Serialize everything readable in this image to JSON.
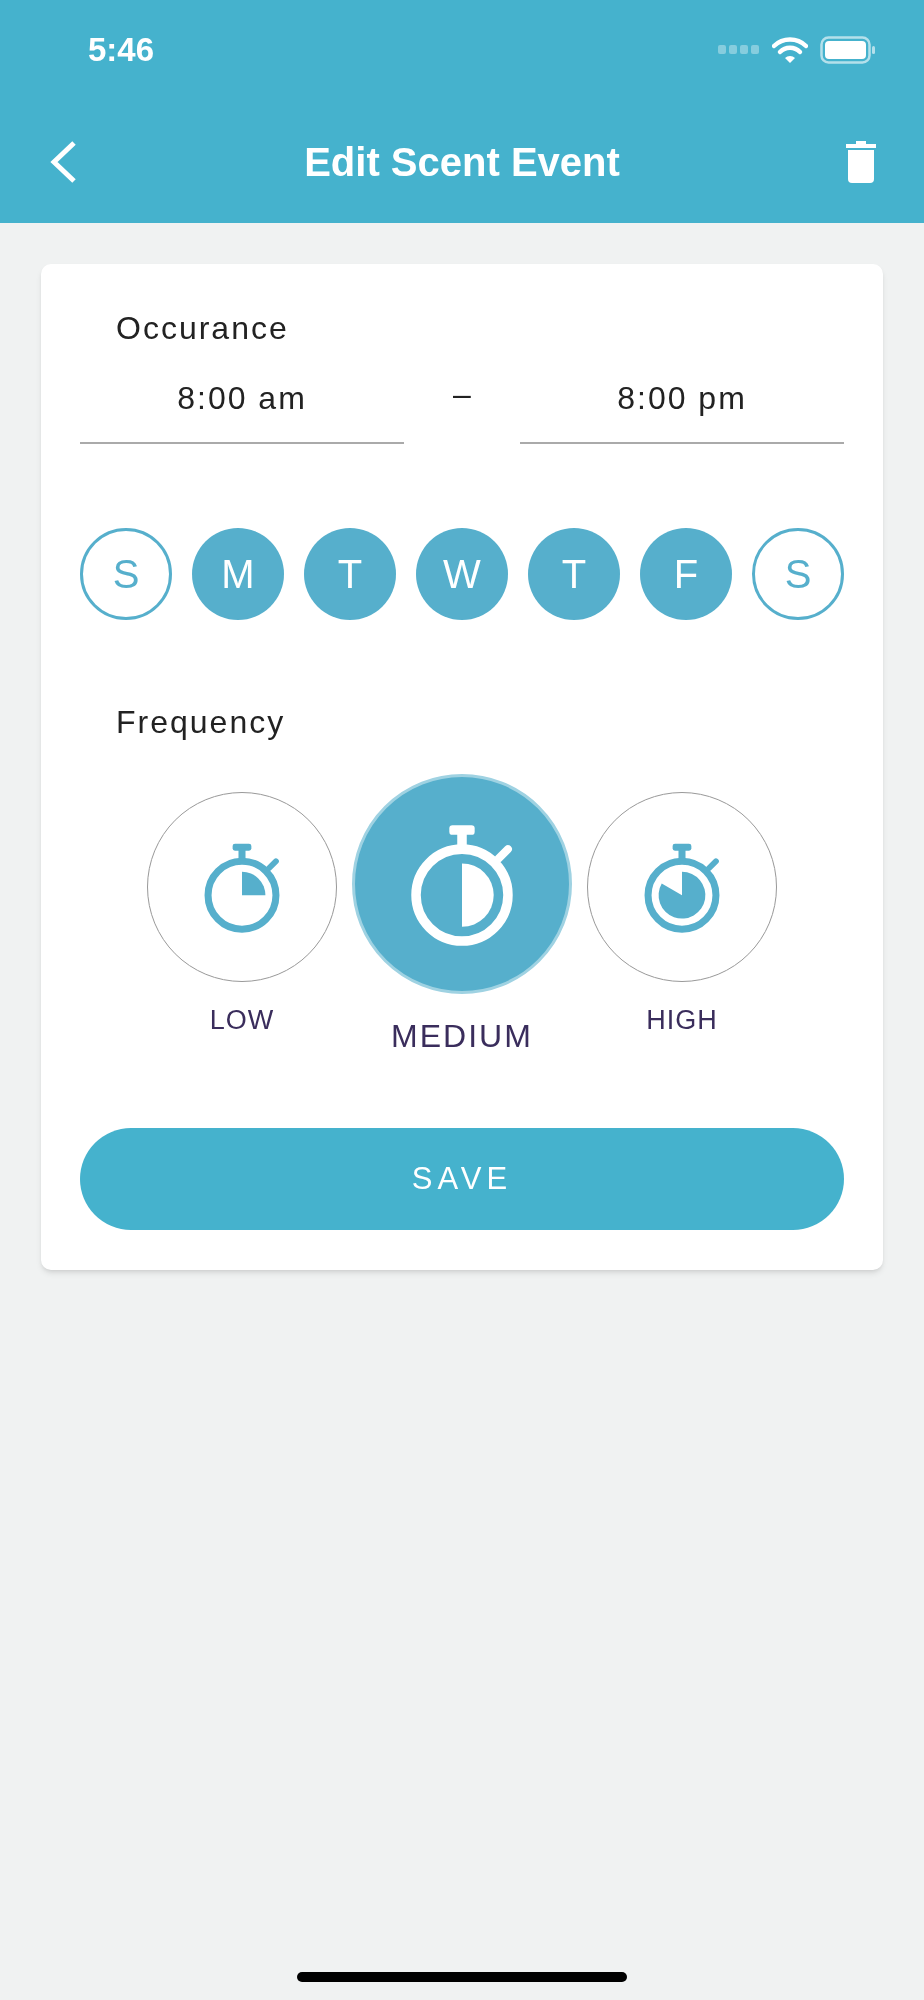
{
  "status_bar": {
    "time": "5:46"
  },
  "header": {
    "title": "Edit Scent Event"
  },
  "occurrence": {
    "label": "Occurance",
    "start": "8:00 am",
    "separator": "–",
    "end": "8:00 pm"
  },
  "days": [
    {
      "label": "S",
      "selected": false
    },
    {
      "label": "M",
      "selected": true
    },
    {
      "label": "T",
      "selected": true
    },
    {
      "label": "W",
      "selected": true
    },
    {
      "label": "T",
      "selected": true
    },
    {
      "label": "F",
      "selected": true
    },
    {
      "label": "S",
      "selected": false
    }
  ],
  "frequency": {
    "label": "Frequency",
    "options": [
      {
        "label": "LOW",
        "kind": "low",
        "selected": false
      },
      {
        "label": "MEDIUM",
        "kind": "medium",
        "selected": true
      },
      {
        "label": "HIGH",
        "kind": "high",
        "selected": false
      }
    ]
  },
  "save_button": "SAVE"
}
